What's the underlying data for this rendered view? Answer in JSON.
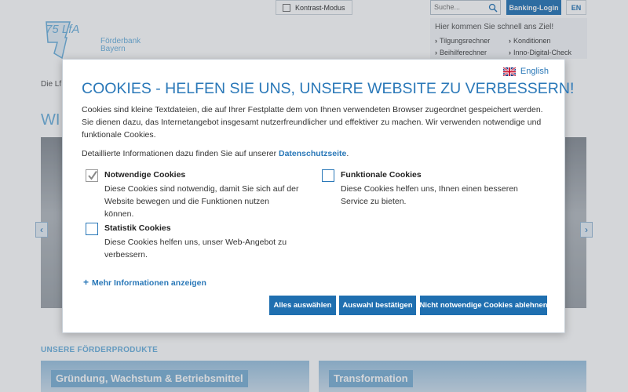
{
  "header": {
    "contrast_label": "Kontrast-Modus",
    "search_placeholder": "Suche...",
    "banking_login": "Banking-Login",
    "lang": "EN"
  },
  "logo": {
    "mark": "75 LfA",
    "line1": "Förderbank",
    "line2": "Bayern"
  },
  "quick_links": {
    "title": "Hier kommen Sie schnell ans Ziel!",
    "items": [
      "Tilgungsrechner",
      "Konditionen",
      "Beihilferechner",
      "Inno-Digital-Check"
    ]
  },
  "background": {
    "breadcrumb": "Die Lf",
    "heading": "WI",
    "products_label": "UNSERE FÖRDERPRODUKTE",
    "cards": [
      "Gründung, Wachstum & Betriebsmittel",
      "Transformation"
    ]
  },
  "modal": {
    "language": "English",
    "title": "COOKIES - HELFEN SIE UNS, UNSERE WEBSITE ZU VERBESSERN!",
    "intro": "Cookies sind kleine Textdateien, die auf Ihrer Festplatte dem von Ihnen verwendeten Browser zugeordnet gespeichert werden. Sie dienen dazu, das Internetangebot insgesamt nutzerfreundlicher und effektiver zu machen. Wir verwenden notwendige und funktionale Cookies.",
    "privacy_prefix": "Detaillierte Informationen dazu finden Sie auf unserer ",
    "privacy_link": "Datenschutzseite",
    "privacy_suffix": ".",
    "options": [
      {
        "title": "Notwendige Cookies",
        "desc": "Diese Cookies sind notwendig, damit Sie sich auf der Website bewegen und die Funktionen nutzen können.",
        "checked": true
      },
      {
        "title": "Funktionale Cookies",
        "desc": "Diese Cookies helfen uns, Ihnen einen besseren Service zu bieten.",
        "checked": false
      },
      {
        "title": "Statistik Cookies",
        "desc": "Diese Cookies helfen uns, unser Web-Angebot zu verbessern.",
        "checked": false
      }
    ],
    "more_info": "Mehr Informationen anzeigen",
    "buttons": {
      "select_all": "Alles auswählen",
      "confirm": "Auswahl bestätigen",
      "reject": "Nicht notwendige Cookies ablehnen"
    }
  },
  "colors": {
    "primary": "#2a78b8",
    "button": "#1f6fb0",
    "light_blue": "#6fb2de"
  }
}
